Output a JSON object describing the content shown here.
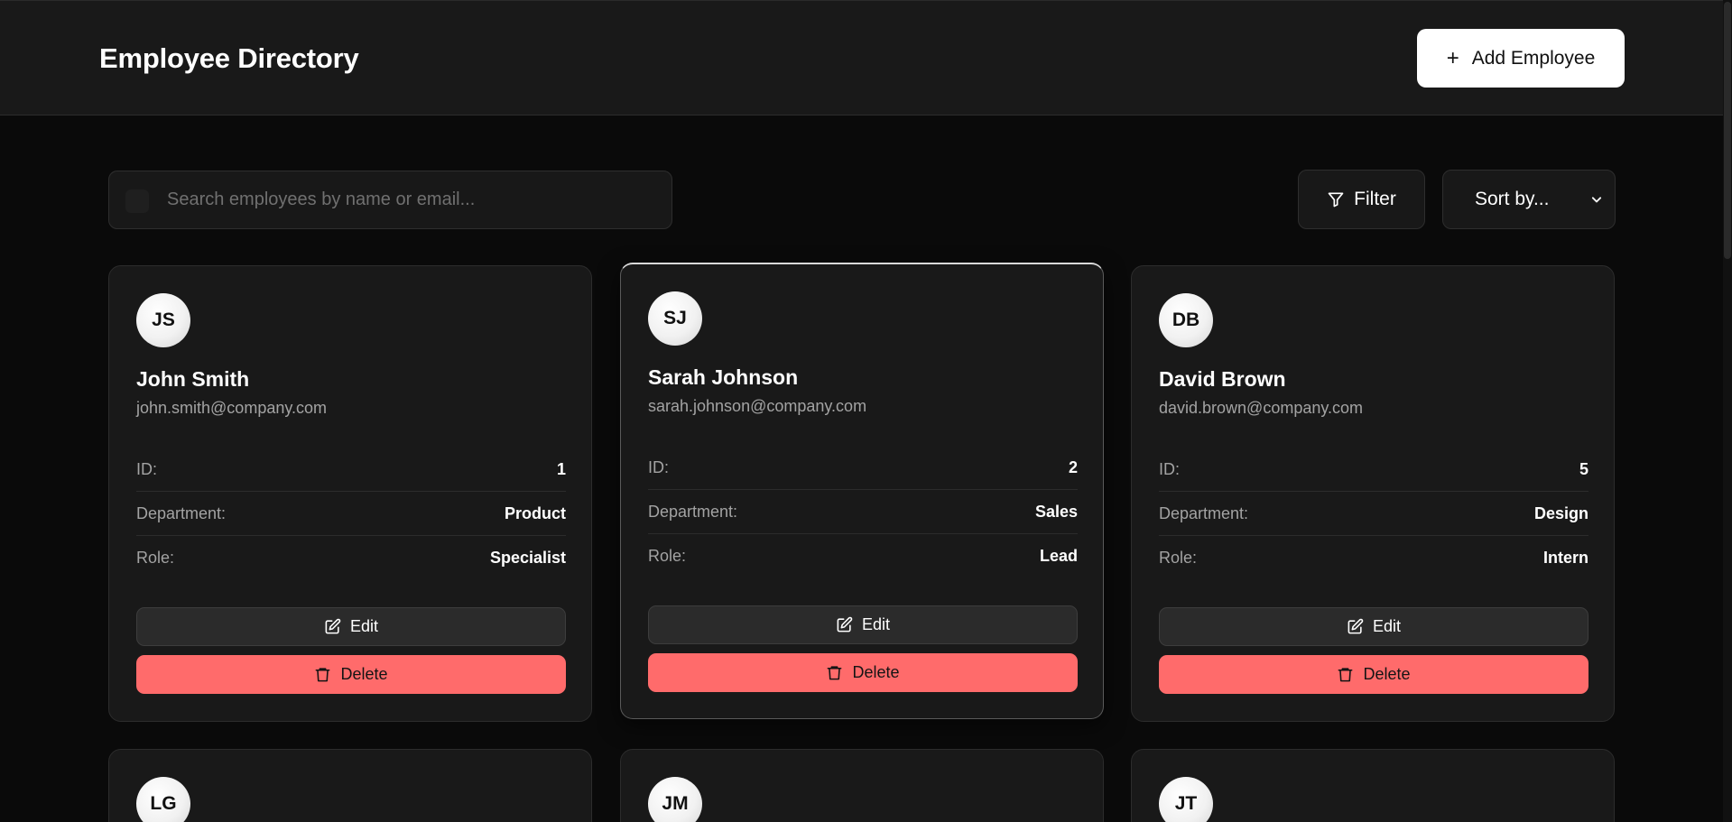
{
  "header": {
    "title": "Employee Directory",
    "add_button_label": "Add Employee",
    "add_button_icon": "plus-icon"
  },
  "toolbar": {
    "search_placeholder": "Search employees by name or email...",
    "search_value": "",
    "filter_label": "Filter",
    "filter_icon": "filter-icon",
    "sort_selected": "Sort by..."
  },
  "card_labels": {
    "id": "ID:",
    "department": "Department:",
    "role": "Role:",
    "edit": "Edit",
    "delete": "Delete"
  },
  "employees": [
    {
      "initials": "JS",
      "name": "John Smith",
      "email": "john.smith@company.com",
      "id": "1",
      "department": "Product",
      "role": "Specialist"
    },
    {
      "initials": "SJ",
      "name": "Sarah Johnson",
      "email": "sarah.johnson@company.com",
      "id": "2",
      "department": "Sales",
      "role": "Lead"
    },
    {
      "initials": "DB",
      "name": "David Brown",
      "email": "david.brown@company.com",
      "id": "5",
      "department": "Design",
      "role": "Intern"
    },
    {
      "initials": "LG"
    },
    {
      "initials": "JM"
    },
    {
      "initials": "JT"
    }
  ],
  "colors": {
    "background": "#0a0a0a",
    "header_bg": "#191919",
    "card_bg": "#191919",
    "delete_accent": "#ff6b6b",
    "primary_button": "#ffffff"
  }
}
